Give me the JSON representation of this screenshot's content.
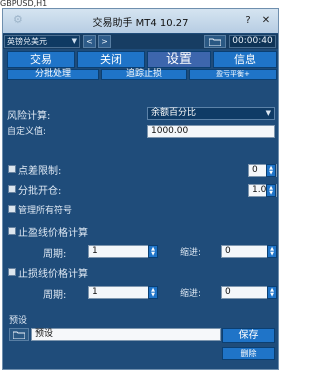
{
  "top_strip": "GBPUSD,H1",
  "window": {
    "title": "交易助手 MT4 10.27",
    "help": "?",
    "close": "✕"
  },
  "toolbar": {
    "symbol": "英镑兑美元",
    "prev": "<",
    "next": ">",
    "time": "00:00:40"
  },
  "tabs": {
    "trade": "交易",
    "close": "关闭",
    "settings": "设置",
    "info": "信息",
    "batch": "分批处理",
    "trailing": "追踪止损",
    "breakeven": "盈亏平衡+"
  },
  "settings": {
    "risk_label": "风险计算:",
    "risk_mode": "余额百分比",
    "custom_label": "自定义值:",
    "custom_value": "1000.00",
    "slippage_label": "点差限制:",
    "slippage_value": "0",
    "split_label": "分批开仓:",
    "split_value": "1.00",
    "manage_label": "管理所有符号",
    "tp_calc_label": "止盈线价格计算",
    "sl_calc_label": "止损线价格计算",
    "period_label": "周期:",
    "indent_label": "缩进:",
    "tp_period": "1",
    "tp_indent": "0",
    "sl_period": "1",
    "sl_indent": "0"
  },
  "preset": {
    "label": "预设",
    "value": "预设",
    "save": "保存",
    "delete": "删除"
  }
}
